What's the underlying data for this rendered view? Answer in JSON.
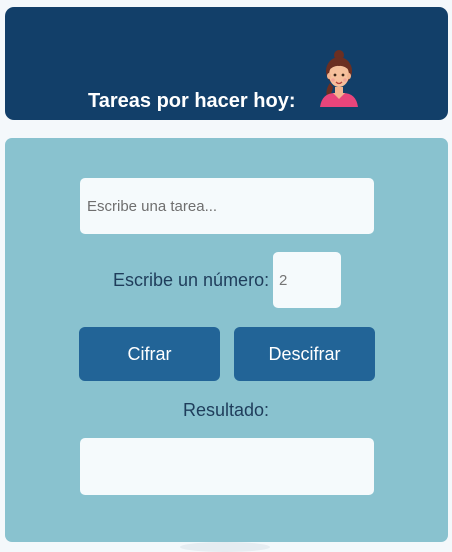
{
  "header": {
    "title": "Tareas por hacer hoy:",
    "avatar_icon": "woman-avatar-icon"
  },
  "task": {
    "placeholder": "Escribe una tarea...",
    "value": ""
  },
  "number": {
    "label": "Escribe un número:",
    "value": "2"
  },
  "buttons": {
    "encrypt_label": "Cifrar",
    "decrypt_label": "Descifrar"
  },
  "result": {
    "label": "Resultado:",
    "value": ""
  },
  "colors": {
    "header_bg": "#123f69",
    "panel_bg": "#89c2cf",
    "button_bg": "#226497",
    "field_bg": "#f5fafc"
  }
}
